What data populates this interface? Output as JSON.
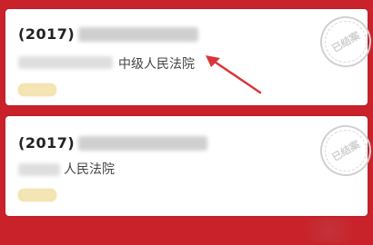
{
  "cards": [
    {
      "case_prefix": "(2017)",
      "court_suffix": "中级人民法院",
      "stamp_text": "已结案"
    },
    {
      "case_prefix": "(2017)",
      "court_suffix": "人民法院",
      "stamp_text": "已结案"
    }
  ],
  "colors": {
    "background": "#c9222a",
    "card": "#ffffff",
    "tag": "#f4e5b4",
    "arrow": "#d8363a"
  }
}
